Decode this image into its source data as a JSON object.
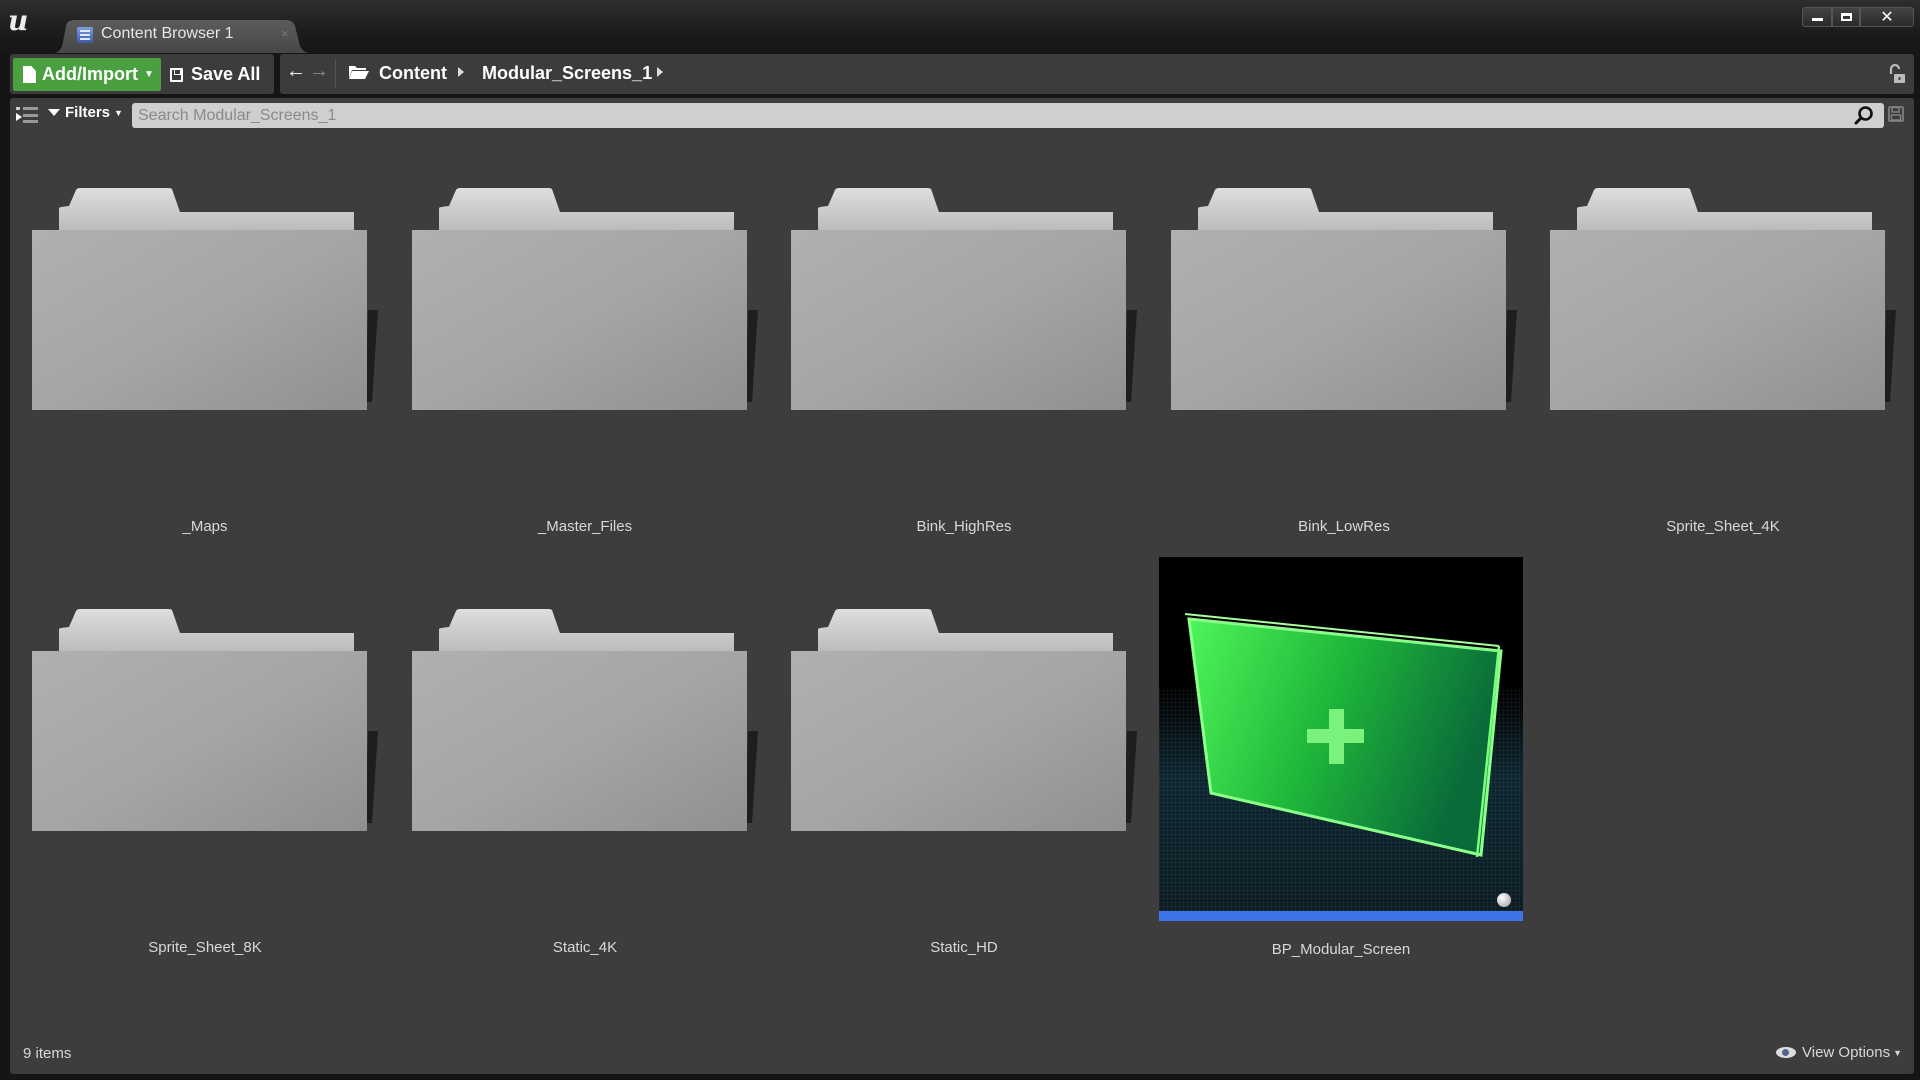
{
  "window": {
    "tab_label": "Content Browser 1",
    "tab_close": "×",
    "controls": {
      "minimize": "—",
      "maximize": "□",
      "close": "✕"
    }
  },
  "toolbar": {
    "add_import_label": "Add/Import",
    "add_import_caret": "▼",
    "save_all_label": "Save All",
    "back_glyph": "🡐",
    "forward_glyph": "🡒",
    "breadcrumb": [
      "Content",
      "Modular_Screens_1"
    ]
  },
  "filter_bar": {
    "filters_label": "Filters",
    "filters_caret": "▼",
    "search_placeholder": "Search Modular_Screens_1",
    "search_value": ""
  },
  "assets": [
    {
      "name": "_Maps",
      "type": "folder"
    },
    {
      "name": "_Master_Files",
      "type": "folder"
    },
    {
      "name": "Bink_HighRes",
      "type": "folder"
    },
    {
      "name": "Bink_LowRes",
      "type": "folder"
    },
    {
      "name": "Sprite_Sheet_4K",
      "type": "folder"
    },
    {
      "name": "Sprite_Sheet_8K",
      "type": "folder"
    },
    {
      "name": "Static_4K",
      "type": "folder"
    },
    {
      "name": "Static_HD",
      "type": "folder"
    },
    {
      "name": "BP_Modular_Screen",
      "type": "blueprint",
      "type_color": "#3d74ea",
      "thumbnail": "green-screen-with-plus"
    }
  ],
  "status_bar": {
    "item_count": "9 items",
    "view_options_label": "View Options",
    "view_options_caret": "▼"
  },
  "colors": {
    "accent_green": "#4a9f3f",
    "panel_bg": "#3d3d3d",
    "blueprint_bar": "#3d74ea",
    "thumb_green": "#39e04a"
  }
}
